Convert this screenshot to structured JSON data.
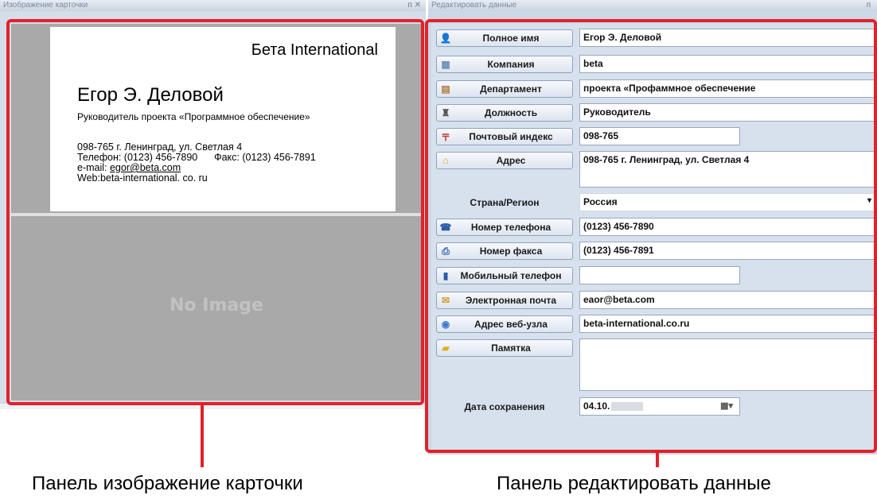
{
  "left_pane": {
    "title": "Изображение карточки",
    "controls": "ᴨ ✕"
  },
  "card": {
    "company": "Бета International",
    "name": "Егор Э. Деловой",
    "title": "Руководитель проекта «Программное обеспечение»",
    "address_line": "098-765 г. Ленинград, ул. Светлая 4",
    "phone_line": "Телефон: (0123) 456-7890",
    "fax_line": "Факс: (0123) 456-7891",
    "email_prefix": "e-mail: ",
    "email": "egor@beta.com",
    "web_line": "Web:beta-international. co. ru"
  },
  "back_side": {
    "placeholder": "No Image"
  },
  "right_pane": {
    "title": "Редактировать данные",
    "controls": "ᴨ"
  },
  "fields": [
    {
      "label": "Полное имя",
      "icon": "person-icon",
      "glyph": "👤",
      "value": "Егор Э. Деловой"
    },
    {
      "label": "Компания",
      "icon": "company-icon",
      "glyph": "▦",
      "value": "beta"
    },
    {
      "label": "Департамент",
      "icon": "department-icon",
      "glyph": "▤",
      "value": "проекта «Профаммное обеспечение"
    },
    {
      "label": "Должность",
      "icon": "position-icon",
      "glyph": "♜",
      "value": "Руководитель"
    },
    {
      "label": "Почтовый индекс",
      "icon": "postal-code-icon",
      "glyph": "〒",
      "value": "098-765"
    },
    {
      "label": "Адрес",
      "icon": "address-icon",
      "glyph": "⌂",
      "value": "098-765 г. Ленинград, ул. Светлая 4"
    },
    {
      "label": "Страна/Регион",
      "value": "Россия"
    },
    {
      "label": "Номер телефона",
      "icon": "phone-icon",
      "glyph": "☎",
      "value": "(0123) 456-7890"
    },
    {
      "label": "Номер факса",
      "icon": "fax-icon",
      "glyph": "⎙",
      "value": "(0123) 456-7891"
    },
    {
      "label": "Мобильный телефон",
      "icon": "mobile-icon",
      "glyph": "▮",
      "value": ""
    },
    {
      "label": "Электронная почта",
      "icon": "email-icon",
      "glyph": "✉",
      "value": "eaor@beta.com"
    },
    {
      "label": "Адрес веб-узла",
      "icon": "web-icon",
      "glyph": "◉",
      "value": "beta-international.co.ru"
    },
    {
      "label": "Памятка",
      "icon": "memo-icon",
      "glyph": "▰",
      "value": ""
    }
  ],
  "save_date": {
    "label": "Дата сохранения",
    "value": "04.10."
  },
  "dropdown_arrow": "▾",
  "calendar_glyph": "▦▾",
  "captions": {
    "left": "Панель изображение карточки",
    "right": "Панель редактировать данные"
  },
  "colors": {
    "highlight": "#e0222a",
    "pane_background": "#cdd8e6"
  }
}
